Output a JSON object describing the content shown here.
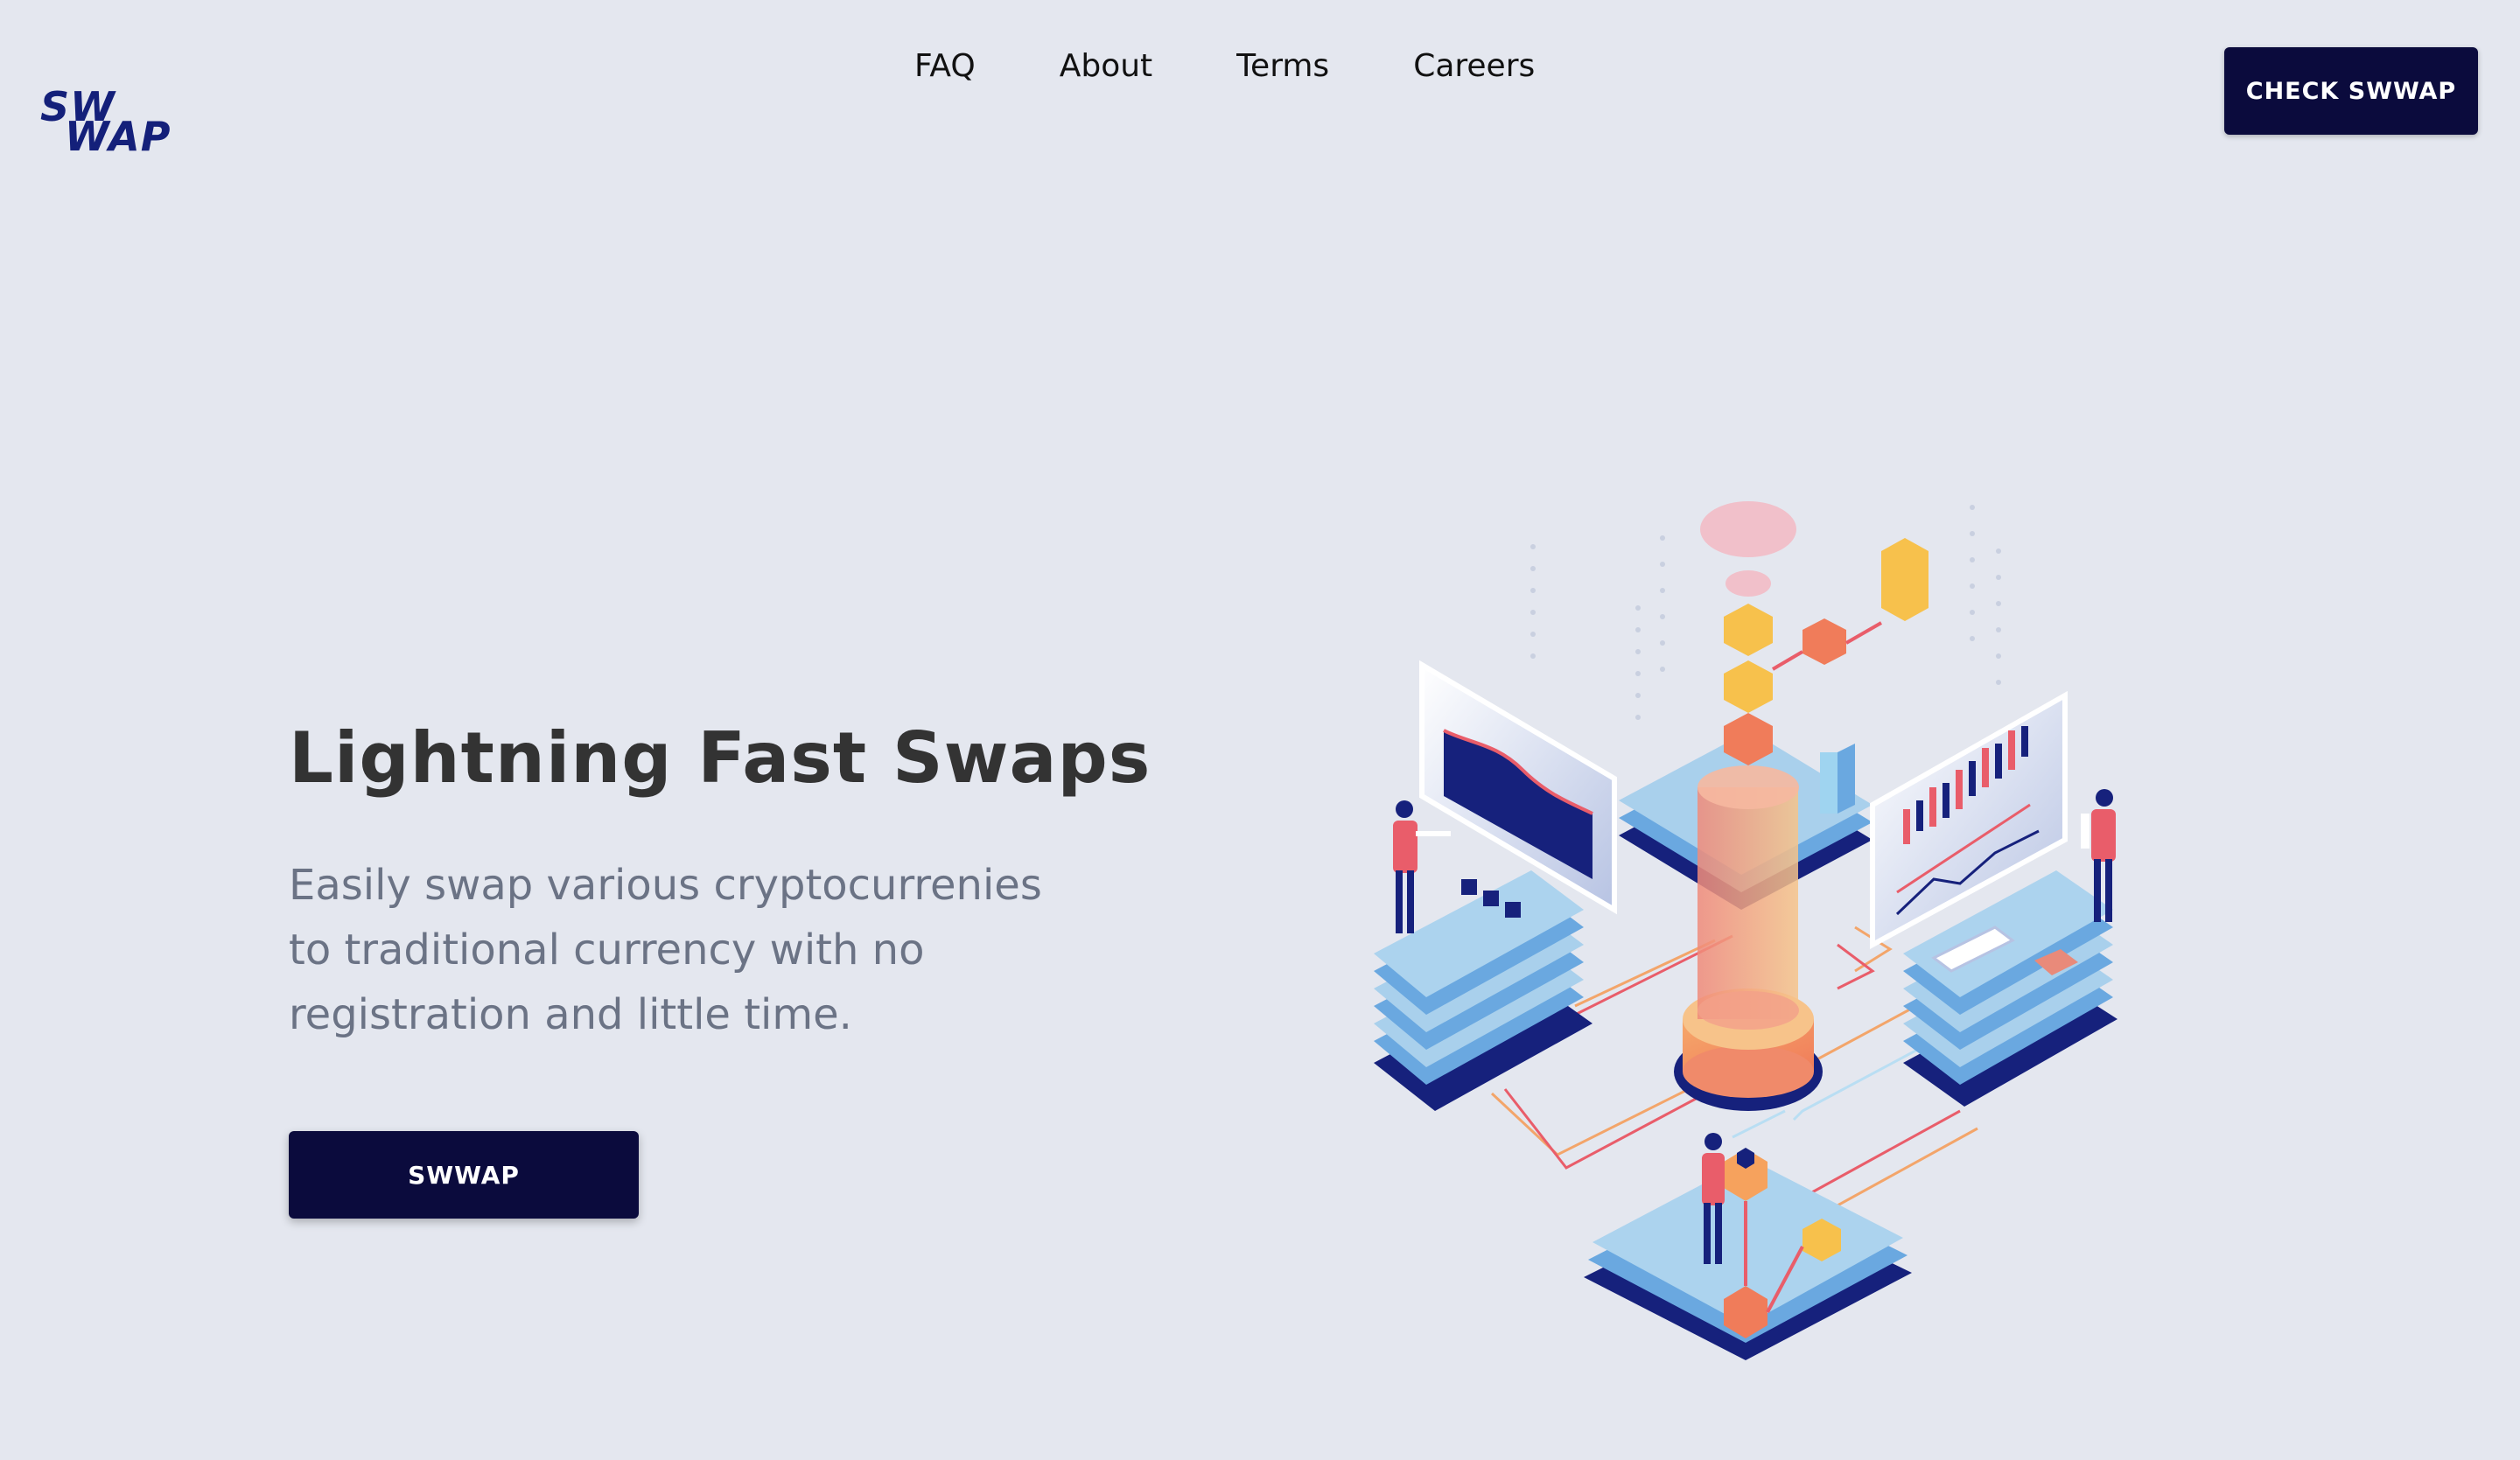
{
  "header": {
    "logo": {
      "line1": "SW",
      "line2": "WAP"
    },
    "nav": [
      {
        "label": "FAQ"
      },
      {
        "label": "About"
      },
      {
        "label": "Terms"
      },
      {
        "label": "Careers"
      }
    ],
    "cta_label": "CHECK SWWAP"
  },
  "hero": {
    "title": "Lightning Fast Swaps",
    "subtitle_lines": [
      "Easily swap various cryptocurrenies",
      "to traditional currency with no",
      "registration and little time."
    ],
    "button_label": "SWWAP"
  },
  "colors": {
    "background": "#e4e7ef",
    "brand_navy": "#0b0b3d",
    "logo_blue": "#14207a",
    "title_text": "#333333",
    "subtitle_text": "#6b7385",
    "platform_blue": "#a9d0ec",
    "accent_orange": "#f5a25d",
    "accent_red": "#e95d6a",
    "accent_yellow": "#f7c14c"
  },
  "illustration": {
    "icon": "crypto-exchange-isometric-illustration"
  }
}
